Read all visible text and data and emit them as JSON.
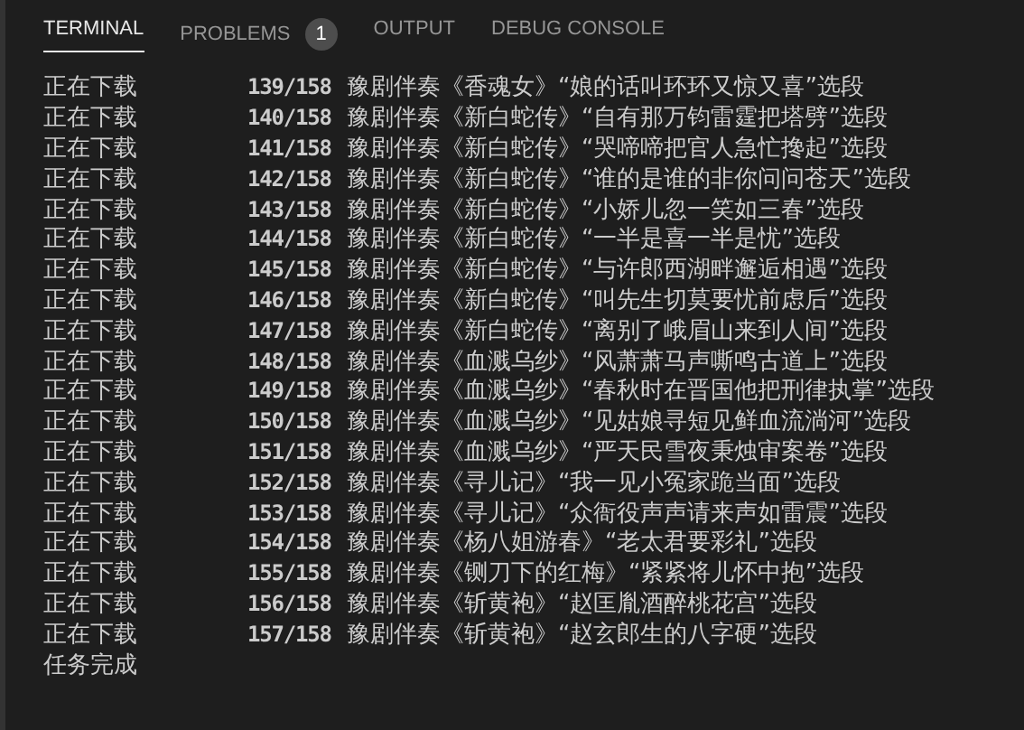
{
  "tabs": [
    {
      "label": "TERMINAL",
      "selected": true
    },
    {
      "label": "PROBLEMS",
      "selected": false,
      "badge": "1"
    },
    {
      "label": "OUTPUT",
      "selected": false
    },
    {
      "label": "DEBUG CONSOLE",
      "selected": false
    }
  ],
  "lines": [
    {
      "status": "正在下载",
      "counter": "139/158",
      "text": "豫剧伴奏《香魂女》“娘的话叫环环又惊又喜”选段"
    },
    {
      "status": "正在下载",
      "counter": "140/158",
      "text": "豫剧伴奏《新白蛇传》“自有那万钧雷霆把塔劈”选段"
    },
    {
      "status": "正在下载",
      "counter": "141/158",
      "text": "豫剧伴奏《新白蛇传》“哭啼啼把官人急忙搀起”选段"
    },
    {
      "status": "正在下载",
      "counter": "142/158",
      "text": "豫剧伴奏《新白蛇传》“谁的是谁的非你问问苍天”选段"
    },
    {
      "status": "正在下载",
      "counter": "143/158",
      "text": "豫剧伴奏《新白蛇传》“小娇儿忽一笑如三春”选段"
    },
    {
      "status": "正在下载",
      "counter": "144/158",
      "text": "豫剧伴奏《新白蛇传》“一半是喜一半是忧”选段"
    },
    {
      "status": "正在下载",
      "counter": "145/158",
      "text": "豫剧伴奏《新白蛇传》“与许郎西湖畔邂逅相遇”选段"
    },
    {
      "status": "正在下载",
      "counter": "146/158",
      "text": "豫剧伴奏《新白蛇传》“叫先生切莫要忧前虑后”选段"
    },
    {
      "status": "正在下载",
      "counter": "147/158",
      "text": "豫剧伴奏《新白蛇传》“离别了峨眉山来到人间”选段"
    },
    {
      "status": "正在下载",
      "counter": "148/158",
      "text": "豫剧伴奏《血溅乌纱》“风萧萧马声嘶鸣古道上”选段"
    },
    {
      "status": "正在下载",
      "counter": "149/158",
      "text": "豫剧伴奏《血溅乌纱》“春秋时在晋国他把刑律执掌”选段"
    },
    {
      "status": "正在下载",
      "counter": "150/158",
      "text": "豫剧伴奏《血溅乌纱》“见姑娘寻短见鲜血流淌河”选段"
    },
    {
      "status": "正在下载",
      "counter": "151/158",
      "text": "豫剧伴奏《血溅乌纱》“严天民雪夜秉烛审案卷”选段"
    },
    {
      "status": "正在下载",
      "counter": "152/158",
      "text": "豫剧伴奏《寻儿记》“我一见小冤家跪当面”选段"
    },
    {
      "status": "正在下载",
      "counter": "153/158",
      "text": "豫剧伴奏《寻儿记》“众衙役声声请来声如雷震”选段"
    },
    {
      "status": "正在下载",
      "counter": "154/158",
      "text": "豫剧伴奏《杨八姐游春》“老太君要彩礼”选段"
    },
    {
      "status": "正在下载",
      "counter": "155/158",
      "text": "豫剧伴奏《铡刀下的红梅》“紧紧将儿怀中抱”选段"
    },
    {
      "status": "正在下载",
      "counter": "156/158",
      "text": "豫剧伴奏《斩黄袍》“赵匡胤酒醉桃花宫”选段"
    },
    {
      "status": "正在下载",
      "counter": "157/158",
      "text": "豫剧伴奏《斩黄袍》“赵玄郎生的八字硬”选段"
    }
  ],
  "footer": "任务完成"
}
